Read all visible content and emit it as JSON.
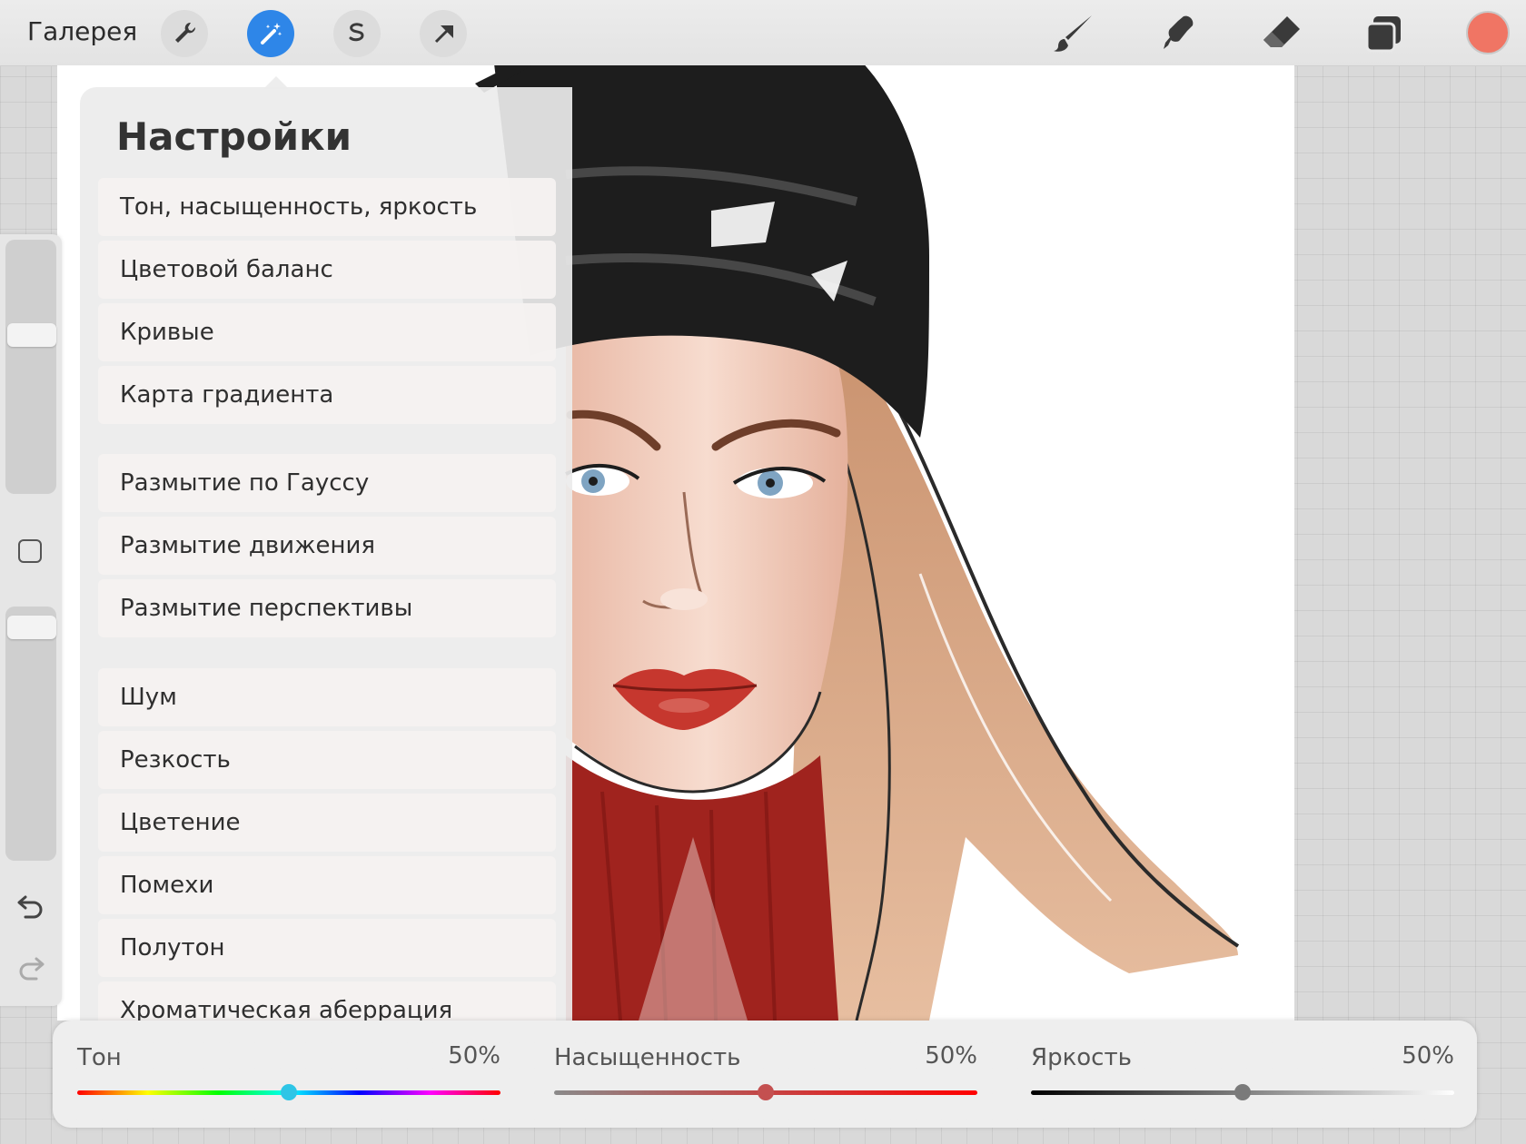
{
  "toolbar": {
    "gallery_label": "Галерея",
    "left_tools": [
      "wrench-icon",
      "magic-wand-icon",
      "selection-icon",
      "transform-arrow-icon"
    ],
    "active_tool": "magic-wand-icon",
    "right_tools": [
      "brush-icon",
      "smudge-icon",
      "eraser-icon",
      "layers-icon"
    ],
    "current_color": "#f07564"
  },
  "panel": {
    "title": "Настройки",
    "groups": [
      [
        "Тон, насыщенность, яркость",
        "Цветовой баланс",
        "Кривые",
        "Карта градиента"
      ],
      [
        "Размытие по Гауссу",
        "Размытие движения",
        "Размытие перспективы"
      ],
      [
        "Шум",
        "Резкость",
        "Цветение",
        "Помехи",
        "Полутон",
        "Хроматическая аберрация"
      ]
    ]
  },
  "sidebar": {
    "icons": [
      "square-modify-icon",
      "undo-icon",
      "redo-icon"
    ],
    "brush_size_level": 0.42,
    "opacity_level": 0.96
  },
  "sliders": [
    {
      "label": "Тон",
      "value": "50%",
      "level": 0.5
    },
    {
      "label": "Насыщенность",
      "value": "50%",
      "level": 0.5
    },
    {
      "label": "Яркость",
      "value": "50%",
      "level": 0.5
    }
  ],
  "colors": {
    "accent": "#2e86e8",
    "hat": "#1d1d1d",
    "skin": "#f2d2c4",
    "hair": "#d9a582",
    "lips": "#c6372e",
    "sweater": "#a0231e"
  }
}
